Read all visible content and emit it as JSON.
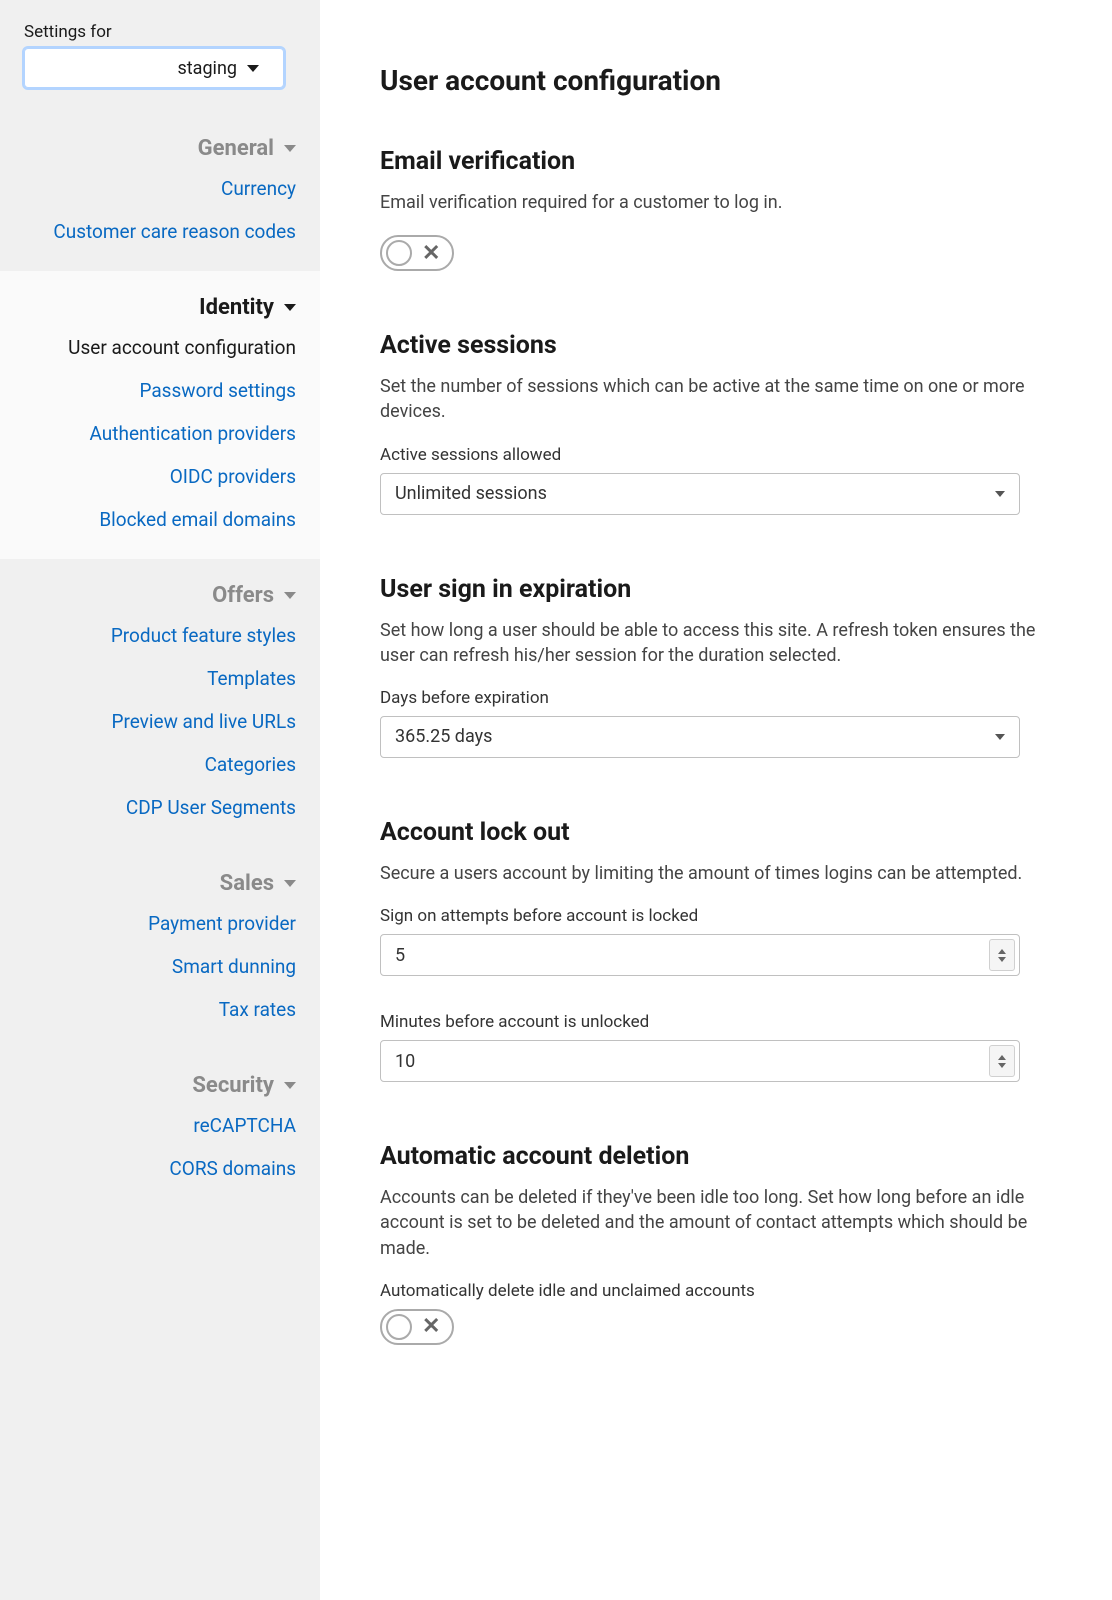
{
  "sidebar": {
    "settingsForLabel": "Settings for",
    "environment": "staging",
    "sections": [
      {
        "title": "General",
        "active": false,
        "items": [
          "Currency",
          "Customer care reason codes"
        ]
      },
      {
        "title": "Identity",
        "active": true,
        "items": [
          "User account configuration",
          "Password settings",
          "Authentication providers",
          "OIDC providers",
          "Blocked email domains"
        ],
        "selectedIndex": 0
      },
      {
        "title": "Offers",
        "active": false,
        "items": [
          "Product feature styles",
          "Templates",
          "Preview and live URLs",
          "Categories",
          "CDP User Segments"
        ]
      },
      {
        "title": "Sales",
        "active": false,
        "items": [
          "Payment provider",
          "Smart dunning",
          "Tax rates"
        ]
      },
      {
        "title": "Security",
        "active": false,
        "items": [
          "reCAPTCHA",
          "CORS domains"
        ]
      }
    ]
  },
  "page": {
    "title": "User account configuration",
    "emailVerification": {
      "heading": "Email verification",
      "desc": "Email verification required for a customer to log in.",
      "enabled": false
    },
    "activeSessions": {
      "heading": "Active sessions",
      "desc": "Set the number of sessions which can be active at the same time on one or more devices.",
      "fieldLabel": "Active sessions allowed",
      "value": "Unlimited sessions"
    },
    "signInExpiration": {
      "heading": "User sign in expiration",
      "desc": "Set how long a user should be able to access this site. A refresh token ensures the user can refresh his/her session for the duration selected.",
      "fieldLabel": "Days before expiration",
      "value": "365.25 days"
    },
    "accountLockout": {
      "heading": "Account lock out",
      "desc": "Secure a users account by limiting the amount of times logins can be attempted.",
      "attemptsLabel": "Sign on attempts before account is locked",
      "attemptsValue": "5",
      "minutesLabel": "Minutes before account is unlocked",
      "minutesValue": "10"
    },
    "autoDeletion": {
      "heading": "Automatic account deletion",
      "desc": "Accounts can be deleted if they've been idle too long. Set how long before an idle account is set to be deleted and the amount of contact attempts which should be made.",
      "toggleLabel": "Automatically delete idle and unclaimed accounts",
      "enabled": false
    }
  }
}
